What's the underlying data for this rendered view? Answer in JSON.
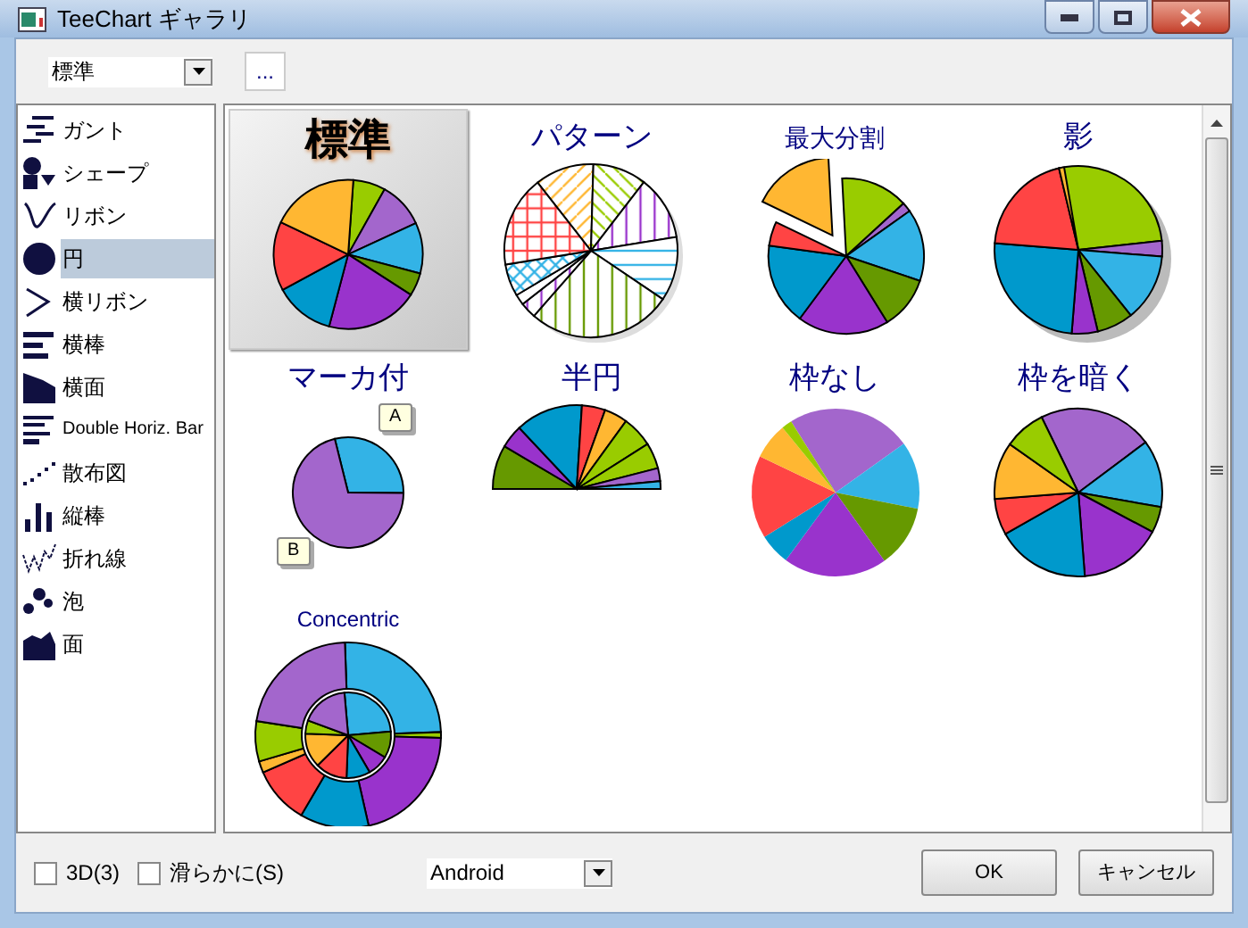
{
  "window": {
    "title": "TeeChart ギャラリ"
  },
  "toolbar": {
    "style_dropdown": {
      "value": "標準"
    },
    "more_button": "..."
  },
  "sidebar": {
    "items": [
      {
        "label": "ガント",
        "selected": false
      },
      {
        "label": "シェープ",
        "selected": false
      },
      {
        "label": "リボン",
        "selected": false
      },
      {
        "label": "円",
        "selected": true
      },
      {
        "label": "横リボン",
        "selected": false
      },
      {
        "label": "横棒",
        "selected": false
      },
      {
        "label": "横面",
        "selected": false
      },
      {
        "label": "Double Horiz. Bar",
        "selected": false
      },
      {
        "label": "散布図",
        "selected": false
      },
      {
        "label": "縦棒",
        "selected": false
      },
      {
        "label": "折れ線",
        "selected": false
      },
      {
        "label": "泡",
        "selected": false
      },
      {
        "label": "面",
        "selected": false
      }
    ]
  },
  "gallery": {
    "tiles": [
      {
        "title": "標準",
        "kind": "standard",
        "selected": true
      },
      {
        "title": "パターン",
        "kind": "pattern",
        "selected": false
      },
      {
        "title": "最大分割",
        "kind": "exploded",
        "selected": false
      },
      {
        "title": "影",
        "kind": "shadow",
        "selected": false
      },
      {
        "title": "マーカ付",
        "kind": "marks",
        "selected": false,
        "marks": [
          "A",
          "B"
        ]
      },
      {
        "title": "半円",
        "kind": "semi",
        "selected": false
      },
      {
        "title": "枠なし",
        "kind": "noborder",
        "selected": false
      },
      {
        "title": "枠を暗く",
        "kind": "darkborder",
        "selected": false
      },
      {
        "title": "Concentric",
        "kind": "concentric",
        "selected": false
      }
    ]
  },
  "footer": {
    "checkboxes": [
      {
        "label": "3D(3)",
        "checked": false
      },
      {
        "label": "滑らかに(S)",
        "checked": false
      }
    ],
    "theme_dropdown": {
      "value": "Android"
    },
    "buttons": [
      "OK",
      "キャンセル"
    ]
  }
}
